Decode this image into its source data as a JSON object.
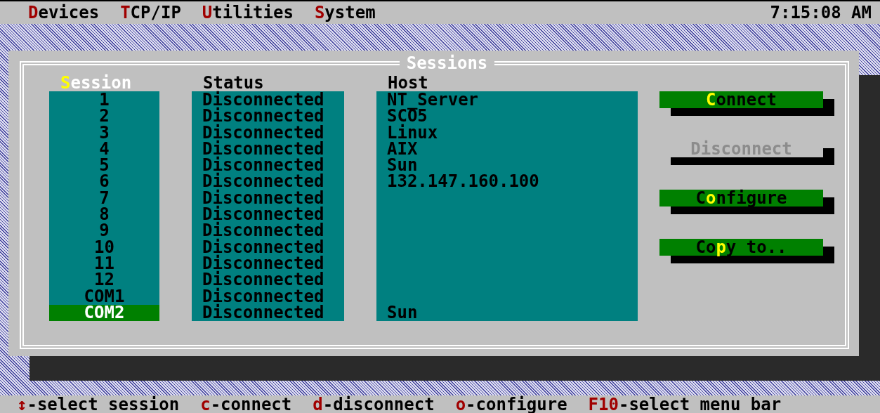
{
  "menu_bar": {
    "items": [
      {
        "key": "D",
        "rest": "evices"
      },
      {
        "key": "T",
        "rest": "CP/IP"
      },
      {
        "key": "U",
        "rest": "tilities"
      },
      {
        "key": "S",
        "rest": "ystem"
      }
    ],
    "clock": "7:15:08 AM"
  },
  "dialog": {
    "title": "Sessions",
    "columns": [
      {
        "kind": "session",
        "key": "S",
        "post": "ession"
      },
      {
        "kind": "status",
        "post": "Status"
      },
      {
        "kind": "host",
        "post": "Host"
      }
    ],
    "rows": [
      {
        "session": "1",
        "status": "Disconnected",
        "host": "NT_Server",
        "selected": false
      },
      {
        "session": "2",
        "status": "Disconnected",
        "host": "SCO5",
        "selected": false
      },
      {
        "session": "3",
        "status": "Disconnected",
        "host": "Linux",
        "selected": false
      },
      {
        "session": "4",
        "status": "Disconnected",
        "host": "AIX",
        "selected": false
      },
      {
        "session": "5",
        "status": "Disconnected",
        "host": "Sun",
        "selected": false
      },
      {
        "session": "6",
        "status": "Disconnected",
        "host": "132.147.160.100",
        "selected": false
      },
      {
        "session": "7",
        "status": "Disconnected",
        "selected": false
      },
      {
        "session": "8",
        "status": "Disconnected",
        "selected": false
      },
      {
        "session": "9",
        "status": "Disconnected",
        "selected": false
      },
      {
        "session": "10",
        "status": "Disconnected",
        "selected": false
      },
      {
        "session": "11",
        "status": "Disconnected",
        "selected": false
      },
      {
        "session": "12",
        "status": "Disconnected",
        "selected": false
      },
      {
        "session": "COM1",
        "status": "Disconnected",
        "selected": false
      },
      {
        "session": "COM2",
        "status": "Disconnected",
        "host": "Sun",
        "selected": true
      }
    ],
    "buttons": [
      {
        "key": "C",
        "post": "onnect",
        "disabled": false
      },
      {
        "pre": "Disconnect",
        "disabled": true
      },
      {
        "pre": "C",
        "key": "o",
        "post": "nfigure",
        "disabled": false
      },
      {
        "pre": "Co",
        "key": "p",
        "post": "y to..",
        "disabled": false
      }
    ]
  },
  "status_bar": {
    "hints": [
      {
        "key": "↕",
        "rest": "-select session"
      },
      {
        "key": "c",
        "rest": "-connect"
      },
      {
        "key": "d",
        "rest": "-disconnect"
      },
      {
        "key": "o",
        "rest": "-configure"
      },
      {
        "key": "F10",
        "rest": "-select menu bar"
      }
    ]
  }
}
